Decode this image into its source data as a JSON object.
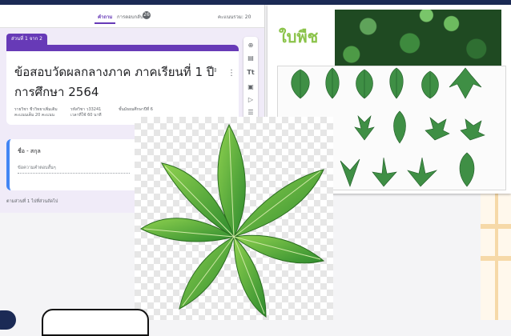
{
  "form": {
    "tabs": [
      {
        "label": "คำถาม"
      },
      {
        "label": "การตอบกลับ"
      }
    ],
    "response_count": "26",
    "score_total": "คะแนนรวม: 20",
    "section_tag": "ส่วนที่ 1 จาก 2",
    "title": "ข้อสอบวัดผลกลางภาค ภาคเรียนที่ 1 ปีการศึกษา 2564",
    "meta": {
      "subject": "รายวิชา ชีววิทยาเพิ่มเติม",
      "score": "คะแนนเต็ม 20 คะแนน",
      "code": "รหัสวิชา ว33241",
      "time": "เวลาที่ใช้ 60 นาที",
      "grade": "ชั้นมัธยมศึกษาปีที่ 6"
    },
    "question": {
      "title": "ชื่อ - สกุล",
      "answer_placeholder": "ข้อความคำตอบสั้นๆ"
    },
    "after_section": "ตามส่วนที่ 1   ไปที่ส่วนถัดไป"
  },
  "slide": {
    "title": "ใบพืช"
  },
  "colors": {
    "form_accent": "#673ab7",
    "leaf_green": "#4caf50",
    "slide_title": "#8bc34a",
    "dark_band": "#1b2a55"
  },
  "icons": [
    "add-question-icon",
    "import-icon",
    "text-icon",
    "image-icon",
    "video-icon",
    "section-icon",
    "more-options-icon",
    "move-icon"
  ]
}
